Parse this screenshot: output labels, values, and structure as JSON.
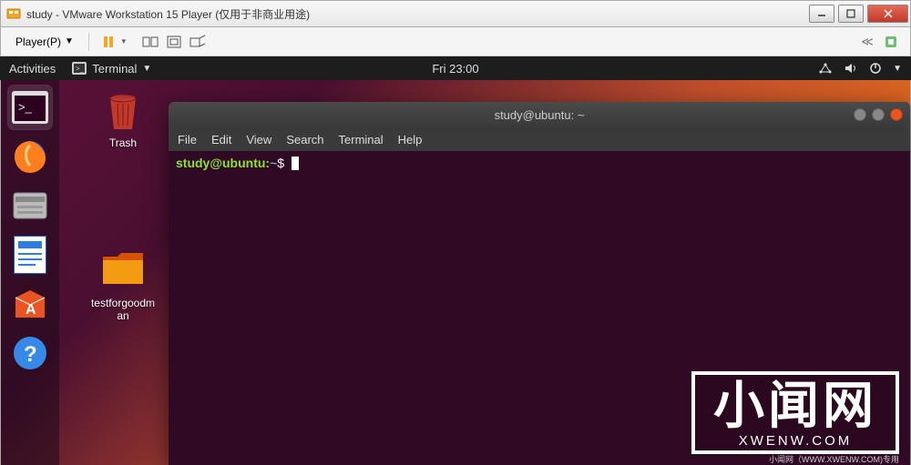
{
  "win": {
    "title": "study - VMware Workstation 15 Player (仅用于非商业用途)"
  },
  "vmware": {
    "player_label": "Player(P)"
  },
  "ubuntu": {
    "activities": "Activities",
    "app_name": "Terminal",
    "clock": "Fri 23:00"
  },
  "desktop": {
    "trash": "Trash",
    "folder": "testforgoodman"
  },
  "terminal": {
    "title": "study@ubuntu: ~",
    "menu": {
      "file": "File",
      "edit": "Edit",
      "view": "View",
      "search": "Search",
      "terminal": "Terminal",
      "help": "Help"
    },
    "prompt_user": "study@ubuntu",
    "prompt_sep": ":",
    "prompt_path": "~",
    "prompt_sym": "$"
  },
  "watermark": {
    "big": "小闻网",
    "small": "XWENW.COM",
    "strip": "小闻网（WWW.XWENW.COM)专用"
  }
}
